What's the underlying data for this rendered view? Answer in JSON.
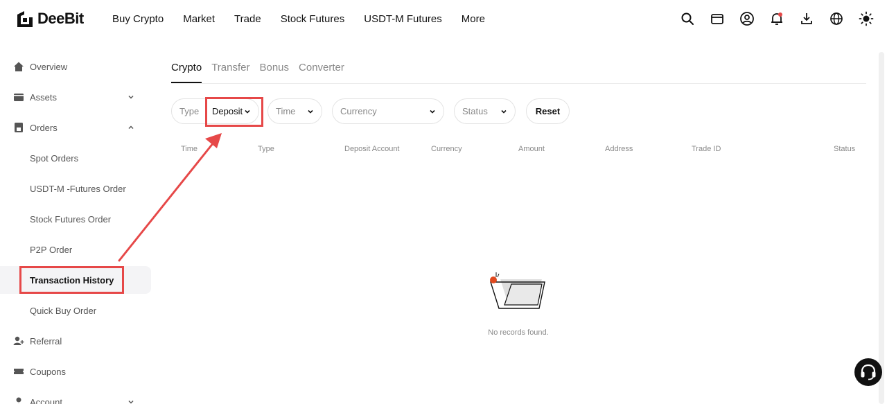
{
  "brand": {
    "name": "DeeBit"
  },
  "nav": [
    {
      "label": "Buy Crypto"
    },
    {
      "label": "Market"
    },
    {
      "label": "Trade"
    },
    {
      "label": "Stock Futures"
    },
    {
      "label": "USDT-M Futures"
    },
    {
      "label": "More"
    }
  ],
  "header_icons": [
    "search-icon",
    "wallet-icon",
    "user-profile-icon",
    "notification-bell-icon",
    "download-icon",
    "globe-icon",
    "theme-sun-icon"
  ],
  "sidebar": {
    "overview": "Overview",
    "assets": "Assets",
    "orders": "Orders",
    "spot_orders": "Spot Orders",
    "usdtm_futures_order": "USDT-M -Futures Order",
    "stock_futures_order": "Stock Futures Order",
    "p2p_order": "P2P Order",
    "transaction_history": "Transaction History",
    "quick_buy_order": "Quick Buy Order",
    "referral": "Referral",
    "coupons": "Coupons",
    "account": "Account"
  },
  "tabs": [
    {
      "label": "Crypto",
      "active": true
    },
    {
      "label": "Transfer",
      "active": false
    },
    {
      "label": "Bonus",
      "active": false
    },
    {
      "label": "Converter",
      "active": false
    }
  ],
  "filters": {
    "type_label": "Type",
    "type_value": "Deposit",
    "time_placeholder": "Time",
    "currency_placeholder": "Currency",
    "status_placeholder": "Status",
    "reset_label": "Reset"
  },
  "table": {
    "columns": [
      "Time",
      "Type",
      "Deposit Account",
      "Currency",
      "Amount",
      "Address",
      "Trade ID",
      "Status"
    ],
    "empty_text": "No records found."
  },
  "colors": {
    "accent_red": "#e64848",
    "text_primary": "#111111",
    "text_secondary": "#888888"
  }
}
